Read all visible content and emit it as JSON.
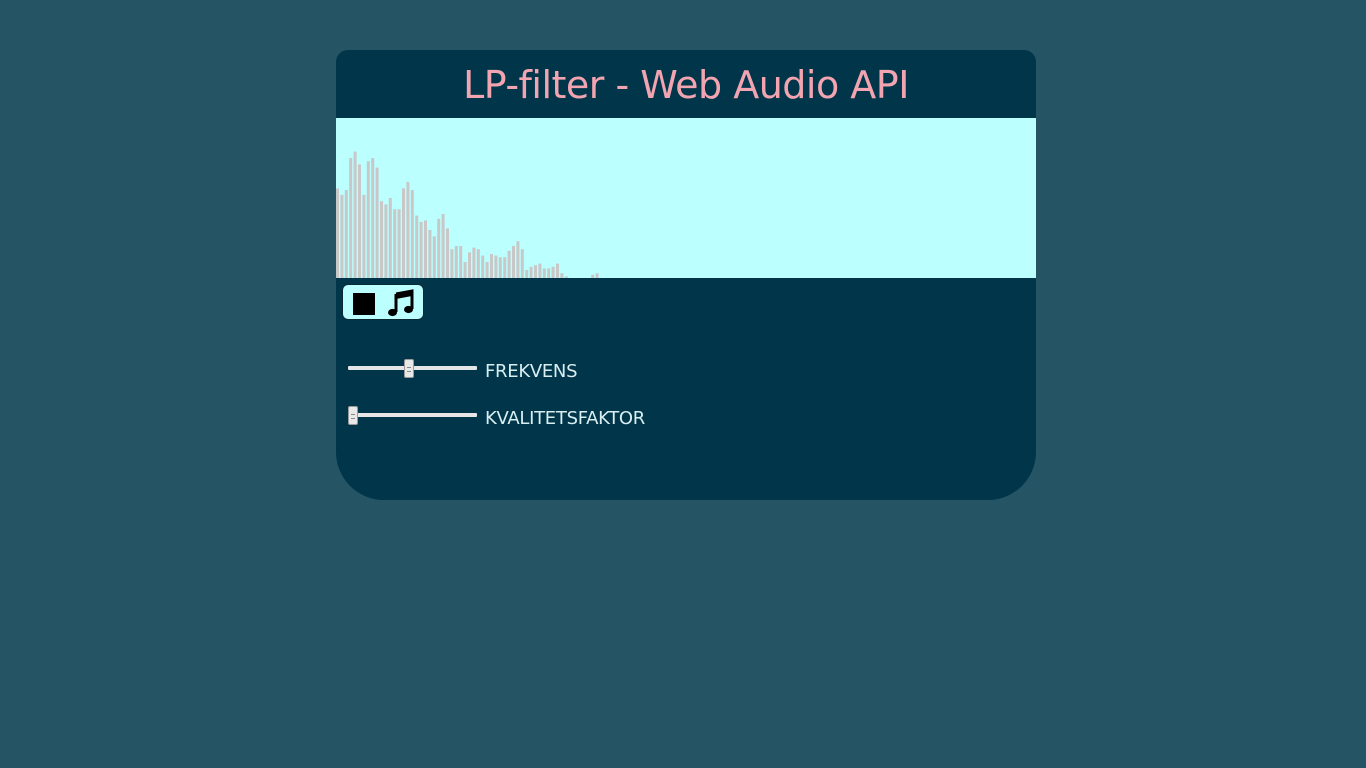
{
  "app": {
    "title": "LP-filter - Web Audio API"
  },
  "visualizer": {
    "bar_color": "#c8c8c8",
    "background": "#bbffff",
    "levels": [
      0.56,
      0.52,
      0.55,
      0.75,
      0.79,
      0.71,
      0.52,
      0.73,
      0.75,
      0.69,
      0.48,
      0.46,
      0.5,
      0.43,
      0.43,
      0.56,
      0.6,
      0.55,
      0.39,
      0.35,
      0.36,
      0.3,
      0.26,
      0.37,
      0.4,
      0.31,
      0.18,
      0.2,
      0.2,
      0.1,
      0.16,
      0.19,
      0.18,
      0.14,
      0.1,
      0.15,
      0.14,
      0.13,
      0.13,
      0.17,
      0.2,
      0.23,
      0.18,
      0.05,
      0.07,
      0.08,
      0.09,
      0.06,
      0.06,
      0.07,
      0.09,
      0.03,
      0.01,
      0.0,
      0.0,
      0.0,
      0.0,
      0.0,
      0.02,
      0.03
    ]
  },
  "controls": {
    "stop_icon": "stop-square-icon",
    "music_icon": "music-note-icon"
  },
  "sliders": {
    "frequency": {
      "label": "FREKVENS",
      "value_fraction": 0.47
    },
    "quality": {
      "label": "KVALITETSFAKTOR",
      "value_fraction": 0.0
    }
  }
}
